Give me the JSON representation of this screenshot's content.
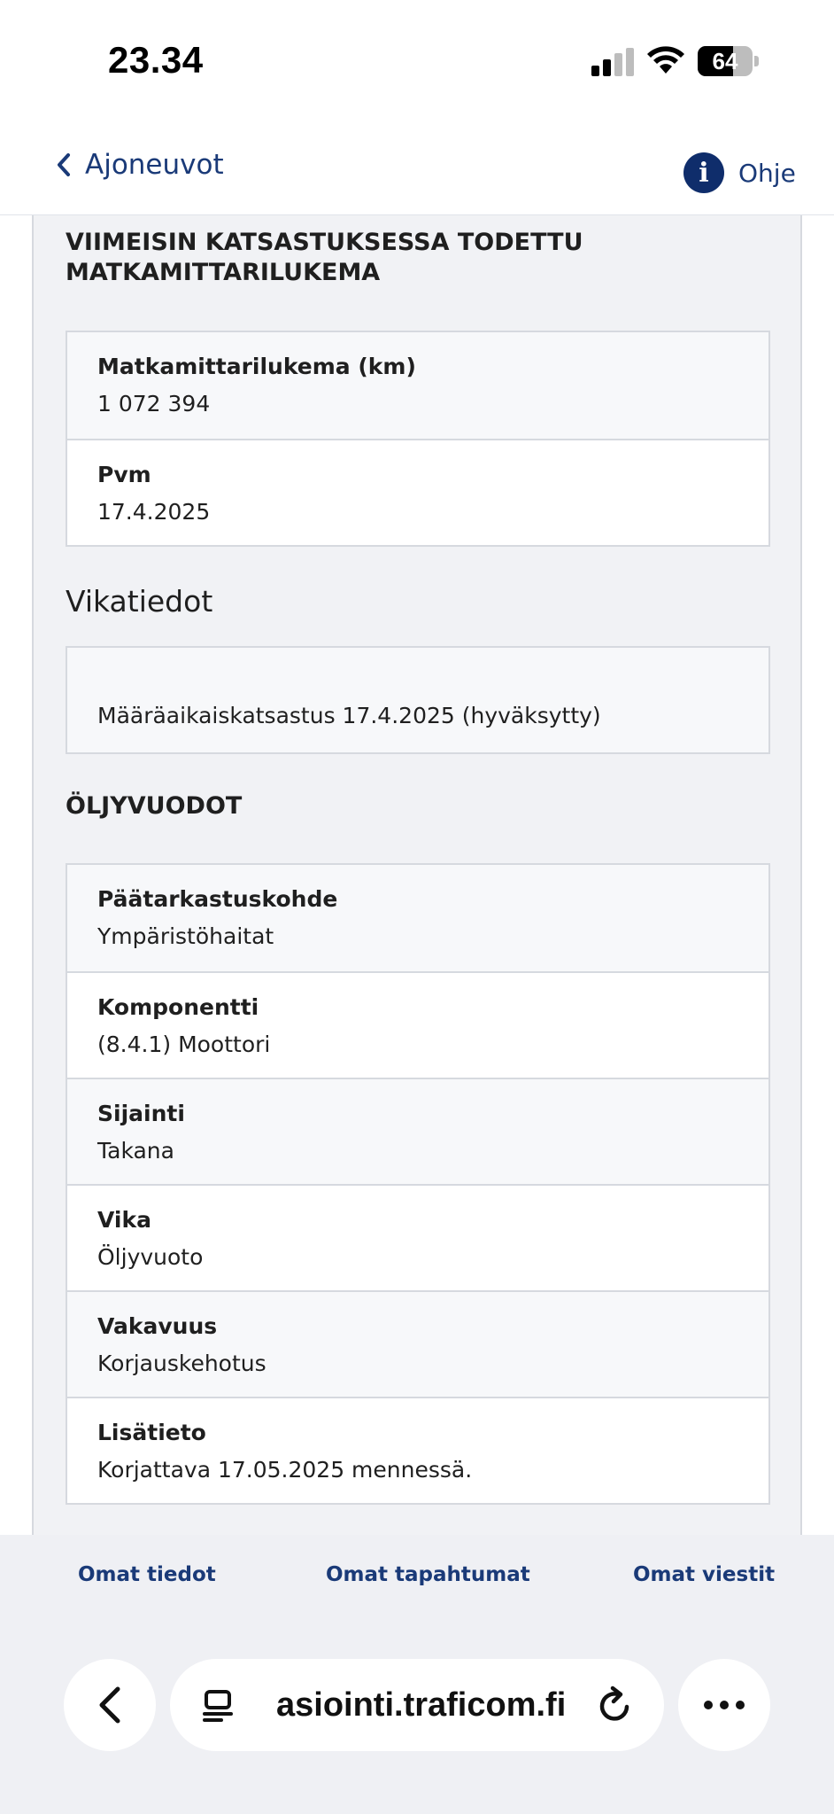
{
  "status_bar": {
    "time": "23.34",
    "battery_level": "64",
    "battery_fraction": 0.64,
    "signal_bars_active": 2,
    "signal_bars_total": 4
  },
  "header": {
    "back_label": "Ajoneuvot",
    "help_label": "Ohje",
    "help_icon_glyph": "i"
  },
  "odometer_section": {
    "title_line1": "VIIMEISIN KATSASTUKSESSA TODETTU",
    "title_line2": "MATKAMITTARILUKEMA",
    "rows": [
      {
        "label": "Matkamittarilukema (km)",
        "value": "1 072 394"
      },
      {
        "label": "Pvm",
        "value": "17.4.2025"
      }
    ]
  },
  "defects_section": {
    "heading": "Vikatiedot",
    "inspection_text": "Määräaikaiskatsastus 17.4.2025 (hyväksytty)"
  },
  "oil_leaks_section": {
    "title": "ÖLJYVUODOT",
    "rows": [
      {
        "label": "Päätarkastuskohde",
        "value": "Ympäristöhaitat"
      },
      {
        "label": "Komponentti",
        "value": "(8.4.1) Moottori"
      },
      {
        "label": "Sijainti",
        "value": "Takana"
      },
      {
        "label": "Vika",
        "value": "Öljyvuoto"
      },
      {
        "label": "Vakavuus",
        "value": "Korjauskehotus"
      },
      {
        "label": "Lisätieto",
        "value": "Korjattava 17.05.2025 mennessä."
      }
    ]
  },
  "bottom_nav": {
    "items": [
      "Omat tiedot",
      "Omat tapahtumat",
      "Omat viestit"
    ]
  },
  "browser": {
    "url": "asiointi.traficom.fi"
  },
  "colors": {
    "accent": "#1a3a78",
    "help_circle": "#0f2d6b",
    "content_bg": "#f1f2f5",
    "border": "#d6d9df"
  }
}
